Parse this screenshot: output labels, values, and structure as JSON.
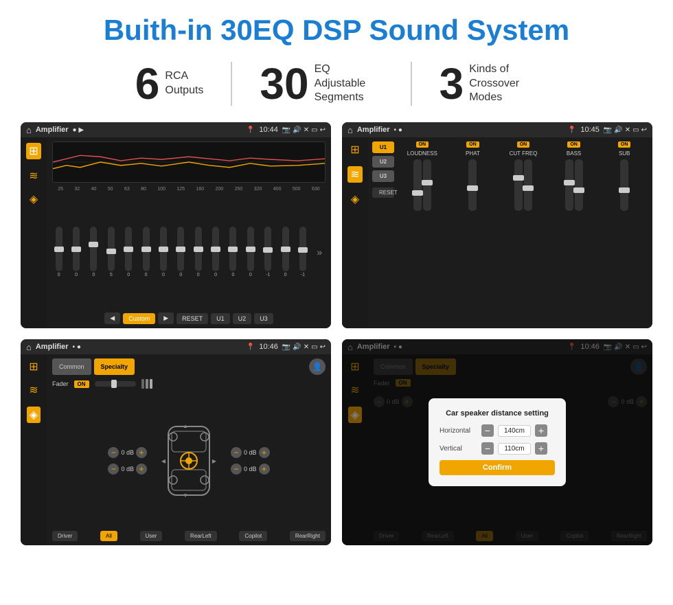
{
  "page": {
    "title": "Buith-in 30EQ DSP Sound System",
    "stats": [
      {
        "number": "6",
        "desc_line1": "RCA",
        "desc_line2": "Outputs"
      },
      {
        "number": "30",
        "desc_line1": "EQ Adjustable",
        "desc_line2": "Segments"
      },
      {
        "number": "3",
        "desc_line1": "Kinds of",
        "desc_line2": "Crossover Modes"
      }
    ],
    "screens": [
      {
        "id": "eq-screen",
        "status_bar": {
          "app": "Amplifier",
          "time": "10:44"
        },
        "type": "equalizer"
      },
      {
        "id": "crossover-screen",
        "status_bar": {
          "app": "Amplifier",
          "time": "10:45"
        },
        "type": "crossover"
      },
      {
        "id": "fader-screen",
        "status_bar": {
          "app": "Amplifier",
          "time": "10:46"
        },
        "type": "fader"
      },
      {
        "id": "distance-screen",
        "status_bar": {
          "app": "Amplifier",
          "time": "10:46"
        },
        "type": "distance",
        "dialog": {
          "title": "Car speaker distance setting",
          "horizontal_label": "Horizontal",
          "horizontal_value": "140cm",
          "vertical_label": "Vertical",
          "vertical_value": "110cm",
          "confirm_label": "Confirm"
        }
      }
    ]
  }
}
